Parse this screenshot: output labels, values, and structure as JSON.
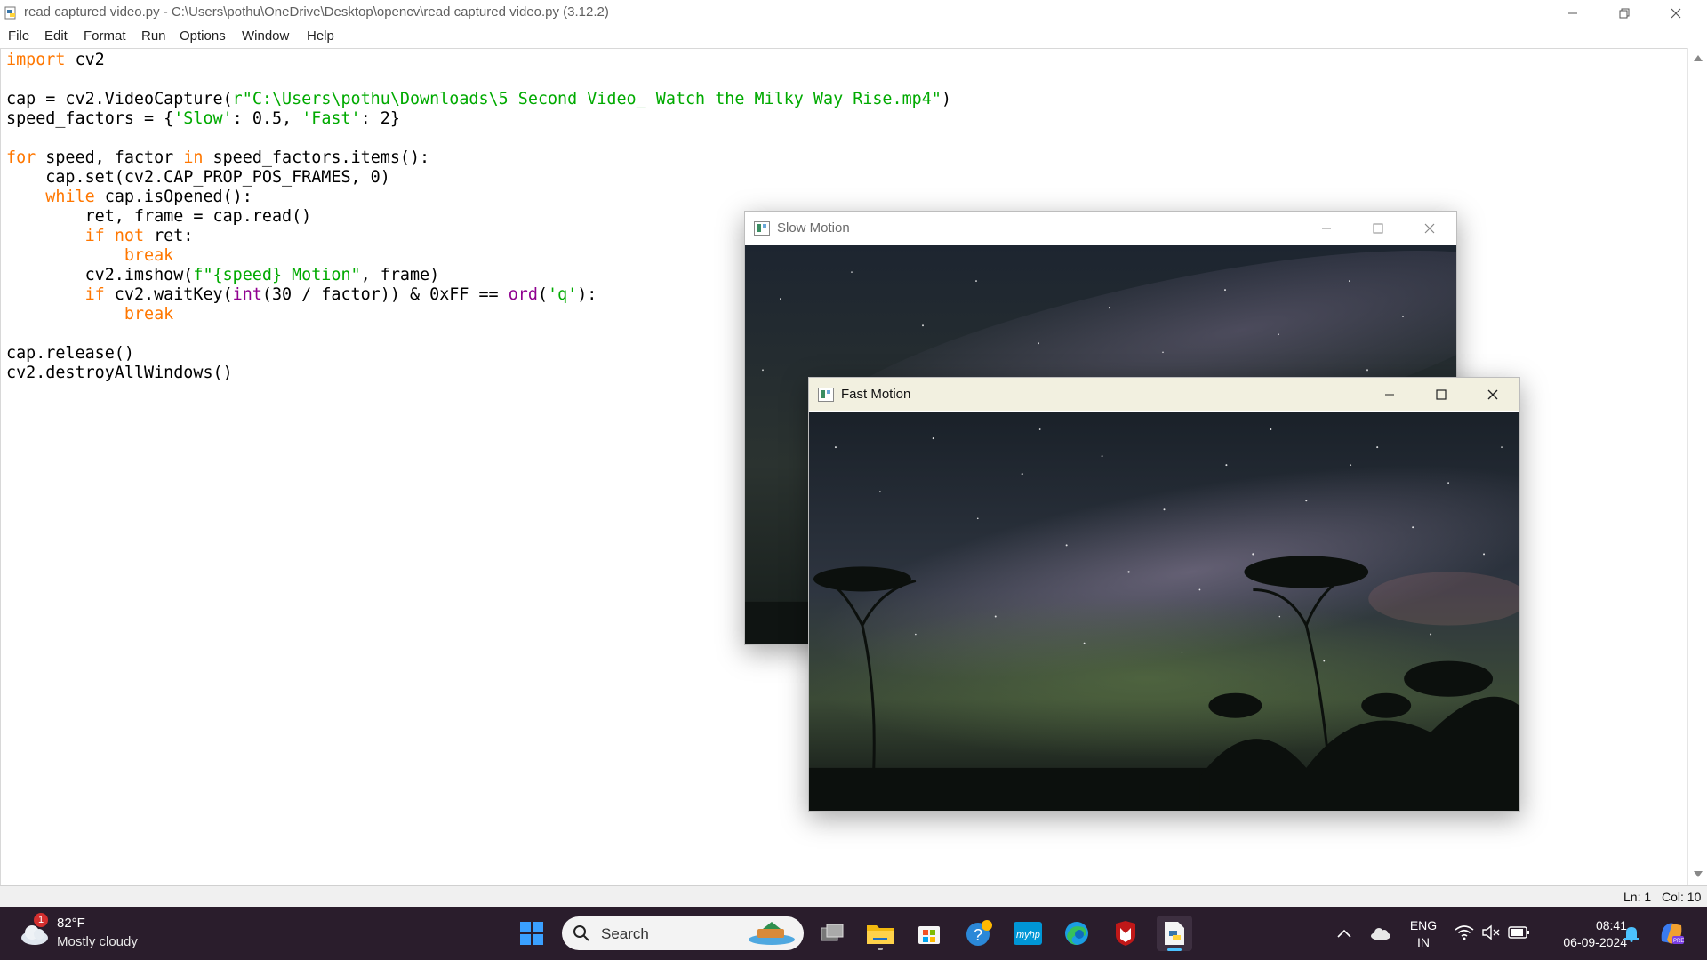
{
  "window": {
    "title": "read captured video.py - C:\\Users\\pothu\\OneDrive\\Desktop\\opencv\\read captured video.py (3.12.2)"
  },
  "menu": [
    "File",
    "Edit",
    "Format",
    "Run",
    "Options",
    "Window",
    "Help"
  ],
  "code": {
    "l1_kw": "import",
    "l1_rest": " cv2",
    "l3_a": "cap = cv2.VideoCapture(",
    "l3_str": "r\"C:\\Users\\pothu\\Downloads\\5 Second Video_ Watch the Milky Way Rise.mp4\"",
    "l3_b": ")",
    "l4_a": "speed_factors = {",
    "l4_s1": "'Slow'",
    "l4_b": ": 0.5, ",
    "l4_s2": "'Fast'",
    "l4_c": ": 2}",
    "l6_kw1": "for",
    "l6_a": " speed, factor ",
    "l6_kw2": "in",
    "l6_b": " speed_factors.items():",
    "l7": "    cap.set(cv2.CAP_PROP_POS_FRAMES, 0)",
    "l8_ind": "    ",
    "l8_kw": "while",
    "l8_rest": " cap.isOpened():",
    "l9": "        ret, frame = cap.read()",
    "l10_ind": "        ",
    "l10_kw1": "if",
    "l10_sp": " ",
    "l10_kw2": "not",
    "l10_rest": " ret:",
    "l11_ind": "            ",
    "l11_kw": "break",
    "l12_a": "        cv2.imshow(",
    "l12_str": "f\"{speed} Motion\"",
    "l12_b": ", frame)",
    "l13_ind": "        ",
    "l13_kw": "if",
    "l13_a": " cv2.waitKey(",
    "l13_bi1": "int",
    "l13_b": "(30 / factor)) & 0xFF == ",
    "l13_bi2": "ord",
    "l13_c": "(",
    "l13_str": "'q'",
    "l13_d": "):",
    "l14_ind": "            ",
    "l14_kw": "break",
    "l16": "cap.release()",
    "l17": "cv2.destroyAllWindows()"
  },
  "status": {
    "line": "Ln: 1",
    "col": "Col: 10"
  },
  "cv_windows": {
    "slow": {
      "title": "Slow Motion"
    },
    "fast": {
      "title": "Fast Motion"
    }
  },
  "taskbar": {
    "weather": {
      "badge": "1",
      "temp": "82°F",
      "desc": "Mostly cloudy"
    },
    "search_placeholder": "Search",
    "lang": "ENG",
    "region": "IN",
    "time": "08:41",
    "date": "06-09-2024"
  },
  "colors": {
    "keyword": "#ff7700",
    "string": "#00aa00",
    "builtin": "#900090",
    "taskbar_bg": "#2a1d2c"
  },
  "icons": [
    "python-file-icon",
    "minimize-icon",
    "restore-icon",
    "close-icon",
    "windows-start-icon",
    "search-icon",
    "task-view-icon",
    "file-explorer-icon",
    "ms-store-icon",
    "get-help-icon",
    "myhp-icon",
    "edge-icon",
    "mcafee-icon",
    "idle-python-icon",
    "chevron-up-icon",
    "onedrive-cloud-icon",
    "wifi-icon",
    "speaker-muted-icon",
    "battery-icon",
    "bell-icon",
    "copilot-icon"
  ]
}
